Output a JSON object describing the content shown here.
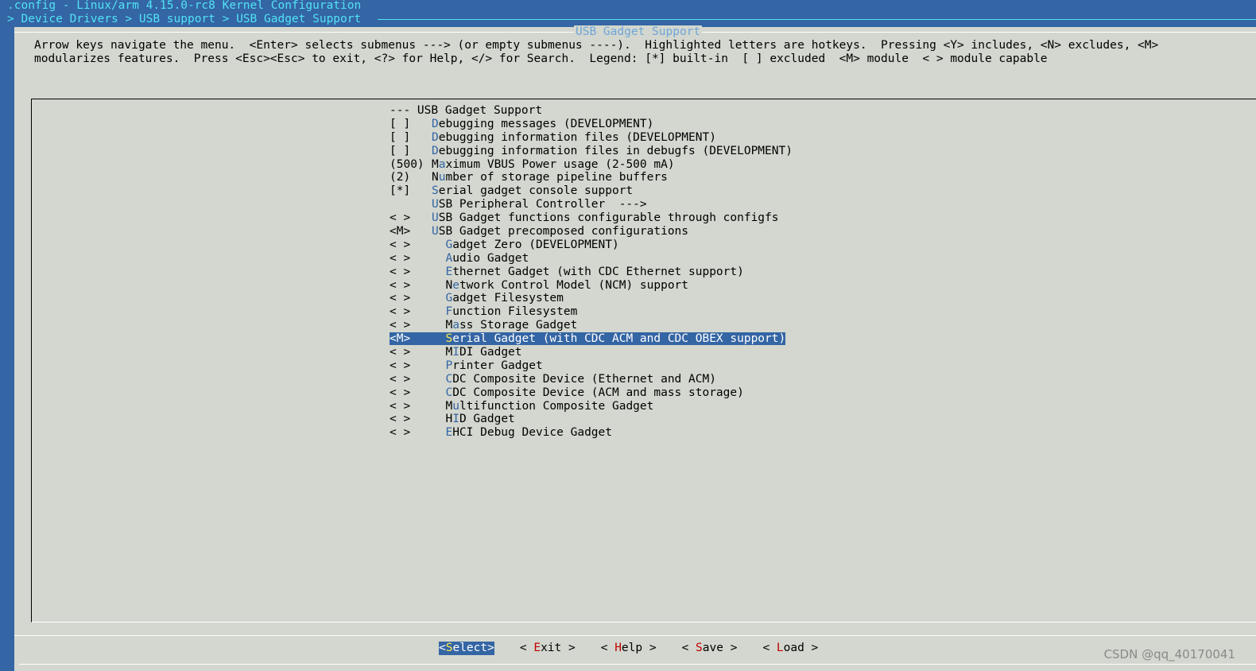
{
  "window": {
    "title": ".config - Linux/arm 4.15.0-rc8 Kernel Configuration",
    "breadcrumb": "> Device Drivers > USB support > USB Gadget Support"
  },
  "dialog": {
    "title": "USB Gadget Support",
    "help_line_1": "Arrow keys navigate the menu.  <Enter> selects submenus ---> (or empty submenus ----).  Highlighted letters are hotkeys.  Pressing <Y> includes, <N> excludes, <M>",
    "help_line_2": "modularizes features.  Press <Esc><Esc> to exit, <?> for Help, </> for Search.  Legend: [*] built-in  [ ] excluded  <M> module  < > module capable"
  },
  "menu": {
    "header": "--- USB Gadget Support",
    "selected_index": 16,
    "items": [
      {
        "state": "[ ]",
        "indent": "",
        "hotkey": "D",
        "rest": "ebugging messages (DEVELOPMENT)"
      },
      {
        "state": "[ ]",
        "indent": "",
        "hotkey": "D",
        "rest": "ebugging information files (DEVELOPMENT)"
      },
      {
        "state": "[ ]",
        "indent": "",
        "hotkey": "D",
        "rest": "ebugging information files in debugfs (DEVELOPMENT)"
      },
      {
        "state": "(500)",
        "indent": "",
        "pre": "M",
        "hotkey": "a",
        "rest": "ximum VBUS Power usage (2-500 mA)"
      },
      {
        "state": "(2)",
        "indent": "",
        "pre": "N",
        "hotkey": "u",
        "rest": "mber of storage pipeline buffers"
      },
      {
        "state": "[*]",
        "indent": "",
        "hotkey": "S",
        "rest": "erial gadget console support"
      },
      {
        "state": "",
        "indent": "",
        "hotkey": "U",
        "rest": "SB Peripheral Controller  --->"
      },
      {
        "state": "< >",
        "indent": "",
        "hotkey": "U",
        "rest": "SB Gadget functions configurable through configfs"
      },
      {
        "state": "<M>",
        "indent": "",
        "hotkey": "U",
        "rest": "SB Gadget precomposed configurations"
      },
      {
        "state": "< >",
        "indent": "  ",
        "hotkey": "G",
        "rest": "adget Zero (DEVELOPMENT)"
      },
      {
        "state": "< >",
        "indent": "  ",
        "hotkey": "A",
        "rest": "udio Gadget"
      },
      {
        "state": "< >",
        "indent": "  ",
        "hotkey": "E",
        "rest": "thernet Gadget (with CDC Ethernet support)"
      },
      {
        "state": "< >",
        "indent": "  ",
        "pre": "N",
        "hotkey": "e",
        "rest": "twork Control Model (NCM) support"
      },
      {
        "state": "< >",
        "indent": "  ",
        "hotkey": "G",
        "rest": "adget Filesystem"
      },
      {
        "state": "< >",
        "indent": "  ",
        "hotkey": "F",
        "rest": "unction Filesystem"
      },
      {
        "state": "< >",
        "indent": "  ",
        "pre": "M",
        "hotkey": "a",
        "rest": "ss Storage Gadget"
      },
      {
        "state": "<M>",
        "indent": "  ",
        "hotkey": "S",
        "rest": "erial Gadget (with CDC ACM and CDC OBEX support)"
      },
      {
        "state": "< >",
        "indent": "  ",
        "pre": "M",
        "hotkey": "I",
        "rest": "DI Gadget"
      },
      {
        "state": "< >",
        "indent": "  ",
        "hotkey": "P",
        "rest": "rinter Gadget"
      },
      {
        "state": "< >",
        "indent": "  ",
        "hotkey": "C",
        "rest": "DC Composite Device (Ethernet and ACM)"
      },
      {
        "state": "< >",
        "indent": "  ",
        "hotkey": "C",
        "rest": "DC Composite Device (ACM and mass storage)"
      },
      {
        "state": "< >",
        "indent": "  ",
        "pre": "M",
        "hotkey": "u",
        "rest": "ltifunction Composite Gadget"
      },
      {
        "state": "< >",
        "indent": "  ",
        "pre": "H",
        "hotkey": "I",
        "rest": "D Gadget"
      },
      {
        "state": "< >",
        "indent": "  ",
        "hotkey": "E",
        "rest": "HCI Debug Device Gadget"
      }
    ]
  },
  "buttons": [
    {
      "pre": "<",
      "hotkey": "S",
      "rest": "elect>",
      "active": true
    },
    {
      "pre": "< ",
      "hotkey": "E",
      "rest": "xit >",
      "active": false
    },
    {
      "pre": "< ",
      "hotkey": "H",
      "rest": "elp >",
      "active": false
    },
    {
      "pre": "< ",
      "hotkey": "S",
      "rest": "ave >",
      "active": false
    },
    {
      "pre": "< ",
      "hotkey": "L",
      "rest": "oad >",
      "active": false
    }
  ],
  "watermark": "CSDN @qq_40170041",
  "colors": {
    "background": "#3465a4",
    "dialog": "#d3d7cf",
    "title_text": "#52e3f5",
    "hotkey": "#3465a4",
    "selection": "#3465a4",
    "button_hotkey": "#c00000",
    "selected_hotkey": "#fce94f"
  }
}
